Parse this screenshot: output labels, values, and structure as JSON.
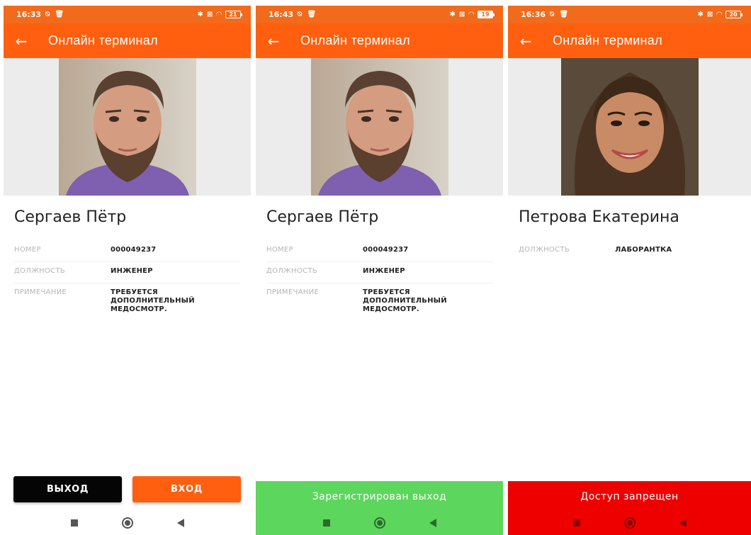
{
  "app": {
    "title": "Онлайн терминал"
  },
  "colors": {
    "primary": "#ff5f0e",
    "status": "#f26a1b",
    "success": "#5cd65c",
    "danger": "#ee0000"
  },
  "screens": [
    {
      "status": {
        "time": "16:33",
        "battery": "21"
      },
      "person": {
        "name": "Сергаев Пётр"
      },
      "fields": [
        {
          "label": "НОМЕР",
          "value": "000049237"
        },
        {
          "label": "ДОЛЖНОСТЬ",
          "value": "ИНЖЕНЕР"
        },
        {
          "label": "ПРИМЕЧАНИЕ",
          "value": "ТРЕБУЕТСЯ ДОПОЛНИТЕЛЬНЫЙ МЕДОСМОТР."
        }
      ],
      "buttons": {
        "exit": "ВЫХОД",
        "enter": "ВХОД"
      }
    },
    {
      "status": {
        "time": "16:43",
        "battery": "19"
      },
      "person": {
        "name": "Сергаев Пётр"
      },
      "fields": [
        {
          "label": "НОМЕР",
          "value": "000049237"
        },
        {
          "label": "ДОЛЖНОСТЬ",
          "value": "ИНЖЕНЕР"
        },
        {
          "label": "ПРИМЕЧАНИЕ",
          "value": "ТРЕБУЕТСЯ ДОПОЛНИТЕЛЬНЫЙ МЕДОСМОТР."
        }
      ],
      "banner": {
        "text": "Зарегистрирован выход"
      }
    },
    {
      "status": {
        "time": "16:36",
        "battery": "20"
      },
      "person": {
        "name": "Петрова Екатерина"
      },
      "fields": [
        {
          "label": "ДОЛЖНОСТЬ",
          "value": "ЛАБОРАНТКА"
        }
      ],
      "banner": {
        "text": "Доступ запрещен"
      }
    }
  ]
}
